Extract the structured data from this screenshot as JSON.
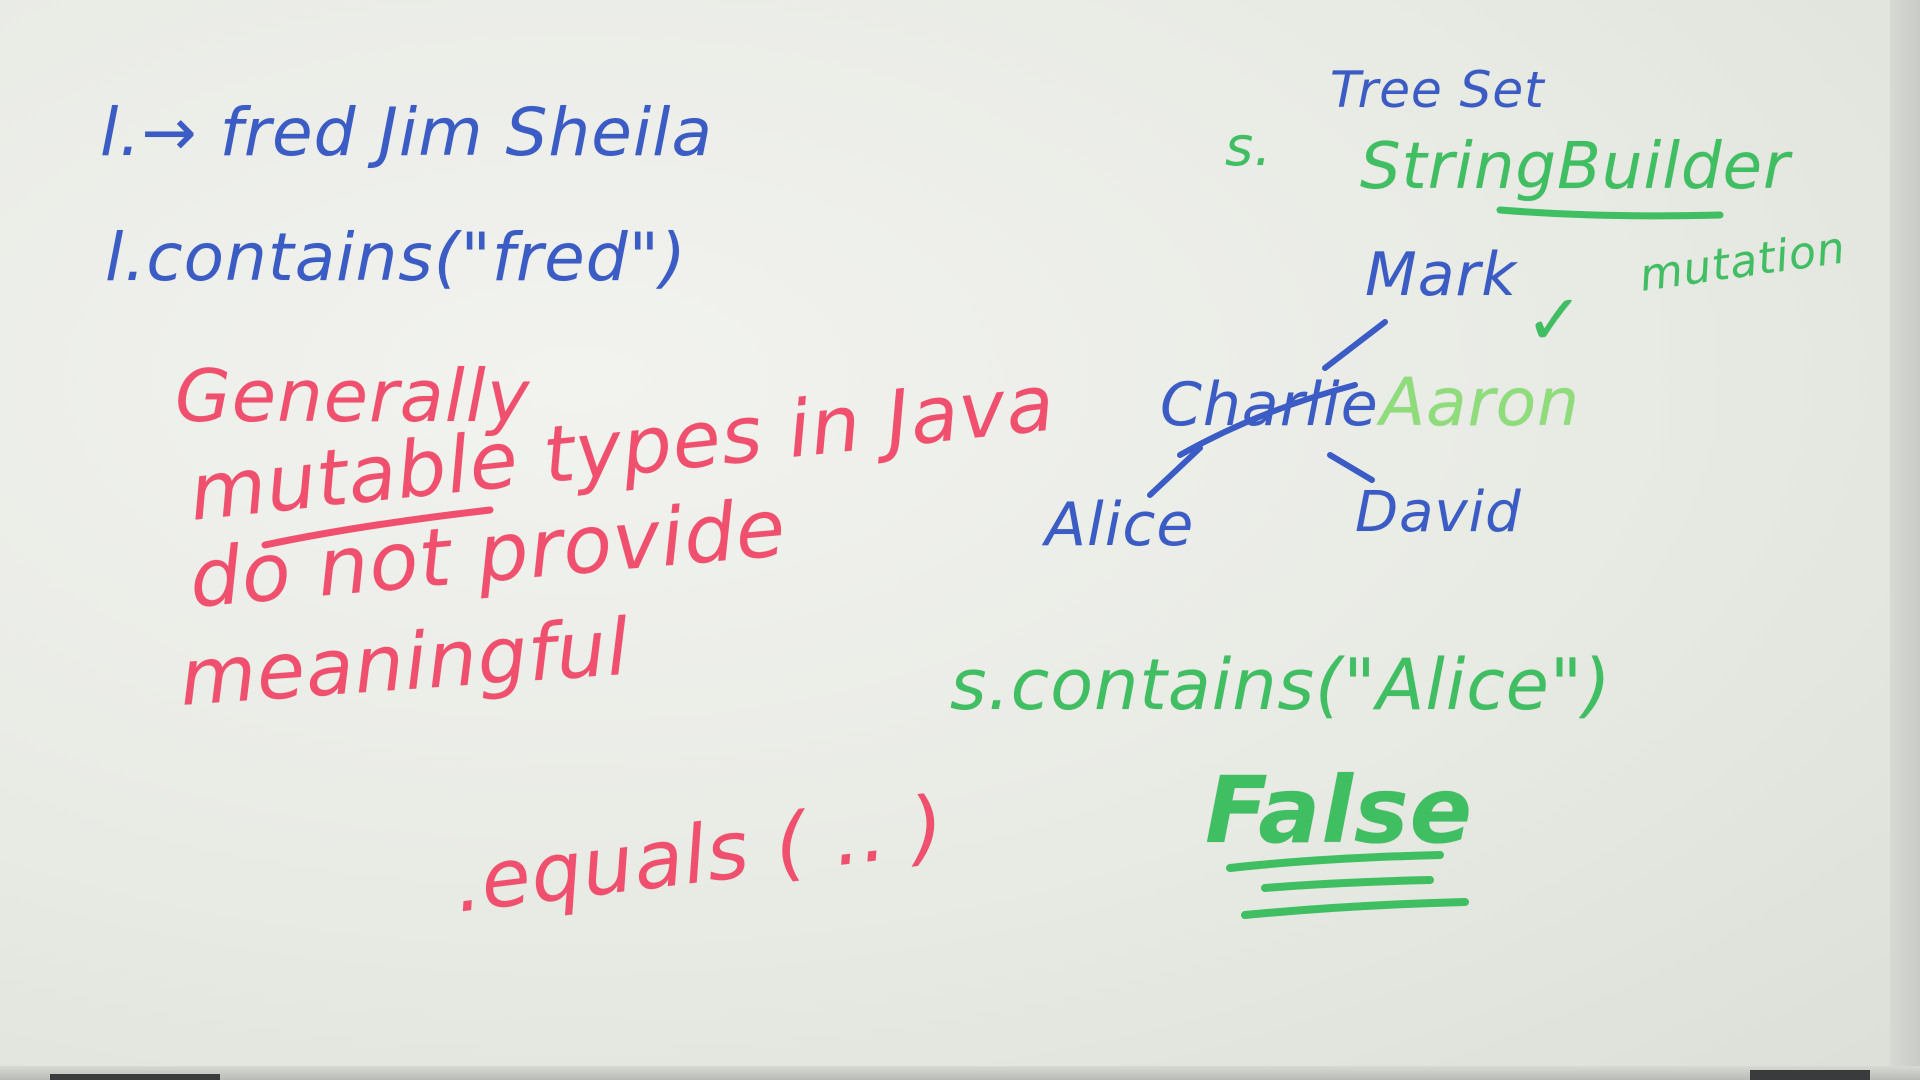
{
  "colors": {
    "board": "#e9ebe6",
    "blue_marker": "#3a5cc4",
    "green_marker": "#3fbe62",
    "light_green_marker": "#8fdc7a",
    "red_marker": "#f0506e"
  },
  "left_blue": {
    "line1": "l.→ fred Jim Sheila",
    "line2": "l.contains(\"fred\")"
  },
  "left_red": {
    "word1": "Generally",
    "line2": "mutable types in Java",
    "line3": "do not provide",
    "line4": "meaningful",
    "line5": ".equals ( .. )"
  },
  "right_top": {
    "tree_set": "Tree Set",
    "s_label": "s.",
    "string_builder": "StringBuilder",
    "mutation": "mutation",
    "check_mark": "✓"
  },
  "tree": {
    "root": "Mark",
    "crossed_node": "Charlie",
    "replacement": "Aaron",
    "left_child": "Alice",
    "right_child": "David"
  },
  "right_bottom": {
    "expression": "s.contains(\"Alice\")",
    "result": "False"
  }
}
